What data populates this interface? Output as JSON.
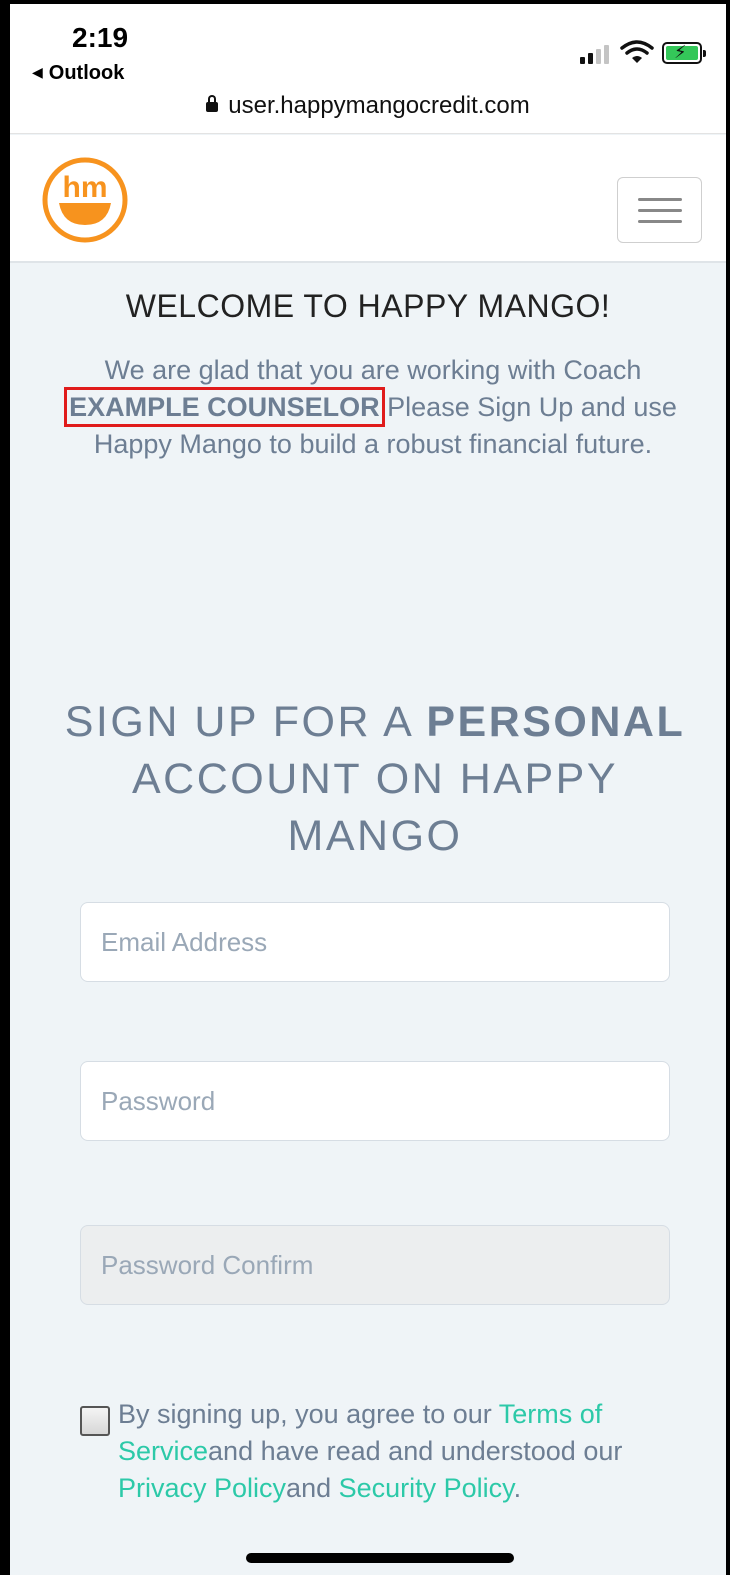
{
  "status_bar": {
    "time": "2:19",
    "back_app": "Outlook",
    "back_icon": "back-triangle-icon",
    "url": "user.happymangocredit.com",
    "url_icon": "lock-icon",
    "icons": [
      "cell-signal-icon",
      "wifi-icon",
      "battery-charging-icon"
    ]
  },
  "header": {
    "logo_icon": "happy-mango-logo-icon",
    "logo_text": "hm",
    "menu_icon": "hamburger-menu-icon"
  },
  "welcome": {
    "title": "WELCOME TO HAPPY MANGO!",
    "text_before": "We are glad that you are working with Coach ",
    "coach_name": "EXAMPLE COUNSELOR",
    "text_after": " Please Sign Up and use Happy Mango to build a robust financial future."
  },
  "signup": {
    "title_part1": "SIGN UP FOR A ",
    "title_bold": "PERSONAL",
    "title_part2": " ACCOUNT ON HAPPY MANGO"
  },
  "form": {
    "email_placeholder": "Email Address",
    "email_value": "",
    "password_placeholder": "Password",
    "password_value": "",
    "password_confirm_placeholder": "Password Confirm",
    "password_confirm_value": "",
    "agree_checked": false,
    "agree_text_1": "By signing up, you agree to our ",
    "terms_link": "Terms of Service",
    "agree_text_2": "and have read and understood our ",
    "privacy_link": "Privacy Policy",
    "agree_text_3": "and ",
    "security_link": "Security Policy",
    "agree_text_4": "."
  },
  "colors": {
    "accent": "#f7931e",
    "link": "#2cc9a8",
    "text": "#6d7e93",
    "highlight_box": "#e01b1b"
  }
}
